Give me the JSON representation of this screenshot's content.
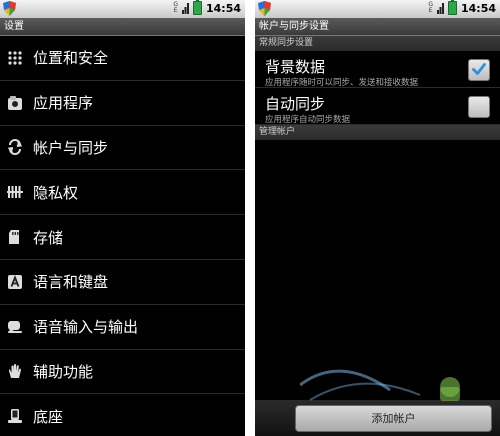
{
  "status": {
    "time": "14:54",
    "signal_text": "G\nE"
  },
  "left": {
    "title": "设置",
    "items": [
      {
        "label": "位置和安全",
        "icon": "grid-icon"
      },
      {
        "label": "应用程序",
        "icon": "apps-icon"
      },
      {
        "label": "帐户与同步",
        "icon": "sync-icon"
      },
      {
        "label": "隐私权",
        "icon": "privacy-icon"
      },
      {
        "label": "存储",
        "icon": "storage-icon"
      },
      {
        "label": "语言和键盘",
        "icon": "keyboard-icon"
      },
      {
        "label": "语音输入与输出",
        "icon": "voice-icon"
      },
      {
        "label": "辅助功能",
        "icon": "accessibility-icon"
      },
      {
        "label": "底座",
        "icon": "dock-icon"
      }
    ]
  },
  "right": {
    "title": "帐户与同步设置",
    "section_general": "常规同步设置",
    "background_data": {
      "title": "背景数据",
      "subtitle": "应用程序随时可以同步、发送和接收数据",
      "checked": true
    },
    "auto_sync": {
      "title": "自动同步",
      "subtitle": "应用程序自动同步数据",
      "checked": false
    },
    "section_manage": "管理帐户",
    "add_account_label": "添加帐户"
  }
}
